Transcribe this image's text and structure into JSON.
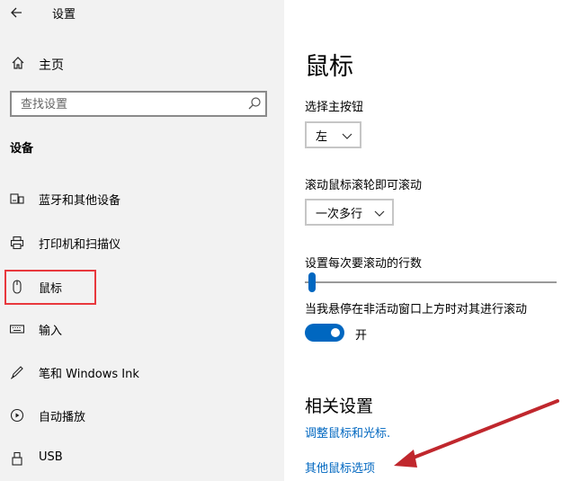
{
  "window": {
    "title": "设置",
    "back_icon": "back-arrow-icon"
  },
  "sidebar": {
    "home": {
      "label": "主页",
      "icon": "home-icon"
    },
    "search": {
      "placeholder": "查找设置",
      "icon": "search-icon"
    },
    "section_title": "设备",
    "items": [
      {
        "label": "蓝牙和其他设备",
        "icon": "bluetooth-devices-icon"
      },
      {
        "label": "打印机和扫描仪",
        "icon": "printer-icon"
      },
      {
        "label": "鼠标",
        "icon": "mouse-icon",
        "selected": true
      },
      {
        "label": "输入",
        "icon": "keyboard-icon"
      },
      {
        "label": "笔和 Windows Ink",
        "icon": "pen-icon"
      },
      {
        "label": "自动播放",
        "icon": "autoplay-icon"
      },
      {
        "label": "USB",
        "icon": "usb-icon"
      }
    ]
  },
  "main": {
    "title": "鼠标",
    "primary_button": {
      "label": "选择主按钮",
      "value": "左"
    },
    "scroll_wheel": {
      "label": "滚动鼠标滚轮即可滚动",
      "value": "一次多行"
    },
    "lines_to_scroll": {
      "label": "设置每次要滚动的行数",
      "value": 0.03
    },
    "inactive_scroll": {
      "label": "当我悬停在非活动窗口上方时对其进行滚动",
      "state": "开",
      "on": true
    },
    "related": {
      "title": "相关设置",
      "links": [
        "调整鼠标和光标.",
        "其他鼠标选项"
      ]
    }
  },
  "colors": {
    "accent": "#0067c0",
    "highlight_box": "#e8383d",
    "annotation_arrow": "#c0272d",
    "sidebar_bg": "#f2f2f2"
  }
}
